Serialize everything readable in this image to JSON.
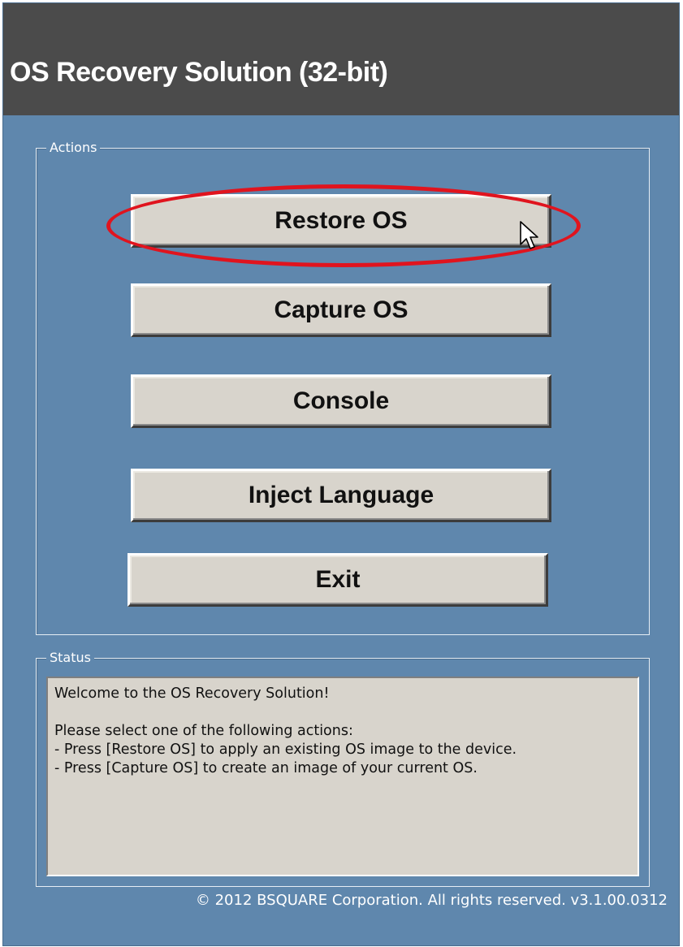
{
  "window": {
    "title": "OS Recovery Solution (32-bit)"
  },
  "actions": {
    "group_label": "Actions",
    "buttons": [
      {
        "label": "Restore OS",
        "highlighted": true
      },
      {
        "label": "Capture OS"
      },
      {
        "label": "Console"
      },
      {
        "label": "Inject Language"
      },
      {
        "label": "Exit"
      }
    ]
  },
  "status": {
    "group_label": "Status",
    "lines": [
      "Welcome to the OS Recovery Solution!",
      "",
      "Please select one of the following actions:",
      "- Press [Restore OS] to apply an existing OS image to the device.",
      "- Press [Capture OS] to create an image of your current OS."
    ]
  },
  "footer": {
    "copyright": "© 2012 BSQUARE Corporation. All rights reserved. v3.1.00.0312"
  },
  "colors": {
    "window_background": "#5f87ad",
    "titlebar": "#4b4b4b",
    "button_face": "#d8d4cc",
    "highlight_ring": "#e0141e"
  },
  "icons": {
    "cursor": "mouse-pointer-icon"
  }
}
